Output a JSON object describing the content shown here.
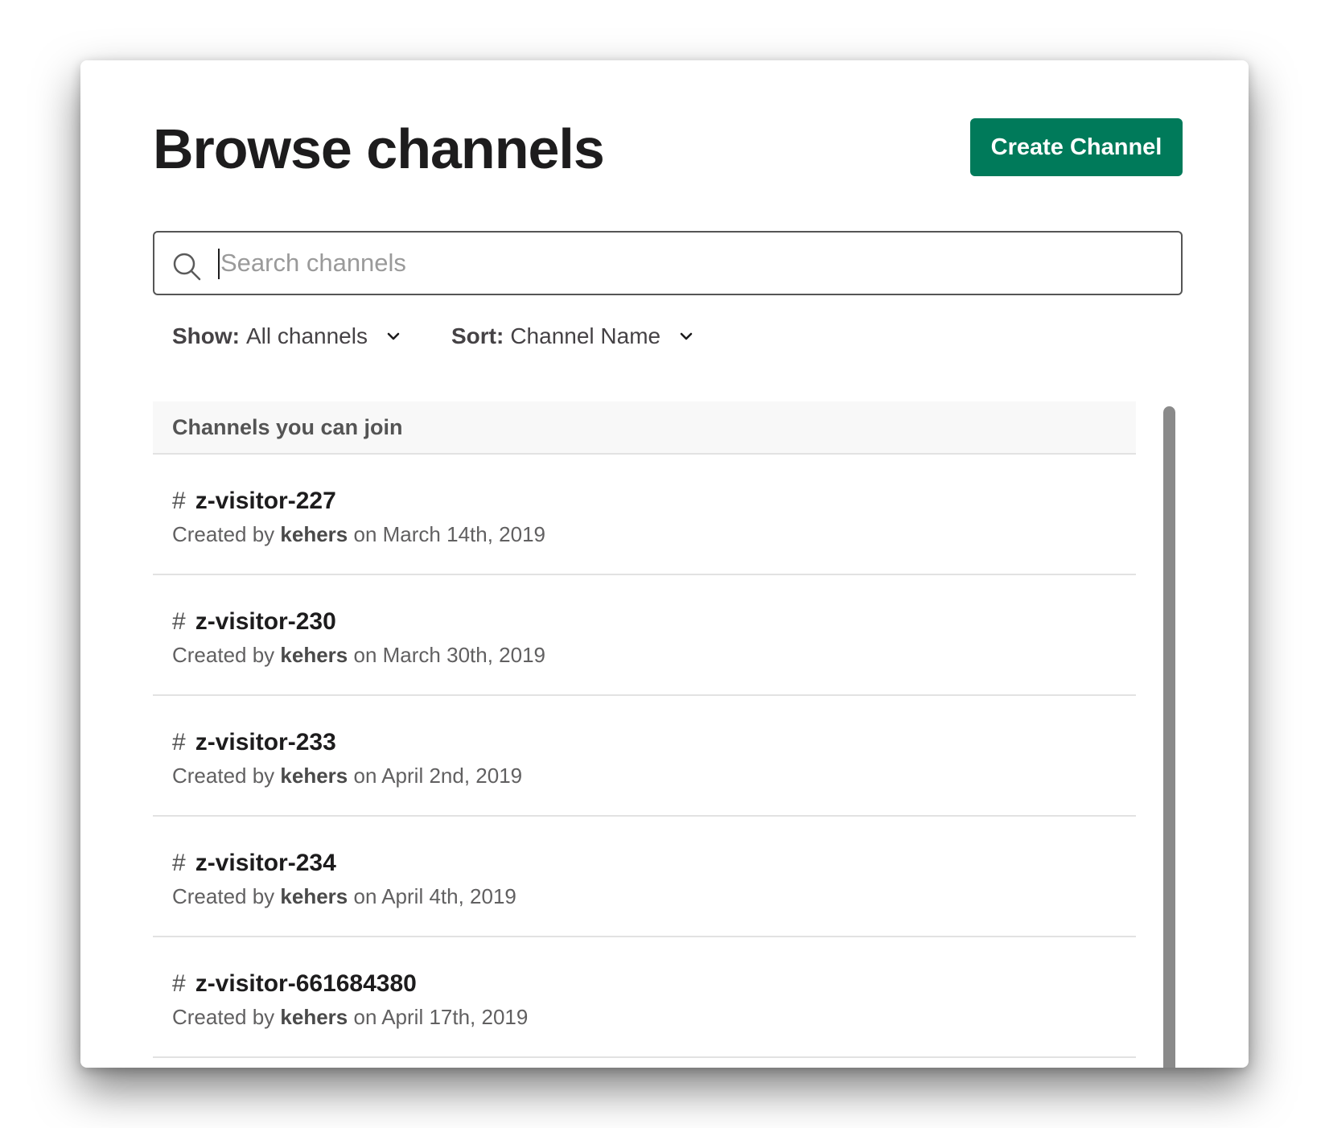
{
  "title": "Browse channels",
  "create_button": "Create Channel",
  "search": {
    "placeholder": "Search channels",
    "value": ""
  },
  "filters": {
    "show": {
      "label": "Show:",
      "value": "All channels"
    },
    "sort": {
      "label": "Sort:",
      "value": "Channel Name"
    }
  },
  "section_title": "Channels you can join",
  "channels": [
    {
      "hash": "#",
      "name": "z-visitor-227",
      "created_prefix": "Created by",
      "creator": "kehers",
      "created_on": "on March 14th, 2019"
    },
    {
      "hash": "#",
      "name": "z-visitor-230",
      "created_prefix": "Created by",
      "creator": "kehers",
      "created_on": "on March 30th, 2019"
    },
    {
      "hash": "#",
      "name": "z-visitor-233",
      "created_prefix": "Created by",
      "creator": "kehers",
      "created_on": "on April 2nd, 2019"
    },
    {
      "hash": "#",
      "name": "z-visitor-234",
      "created_prefix": "Created by",
      "creator": "kehers",
      "created_on": "on April 4th, 2019"
    },
    {
      "hash": "#",
      "name": "z-visitor-661684380",
      "created_prefix": "Created by",
      "creator": "kehers",
      "created_on": "on April 17th, 2019"
    }
  ],
  "colors": {
    "primary_button": "#007a5a",
    "heading_text": "#1d1c1d",
    "section_bg": "#f8f8f8",
    "scrollbar": "#8a8a8a"
  },
  "icons": {
    "search": "search-icon",
    "dropdown": "chevron-down-icon",
    "channel": "hash"
  }
}
